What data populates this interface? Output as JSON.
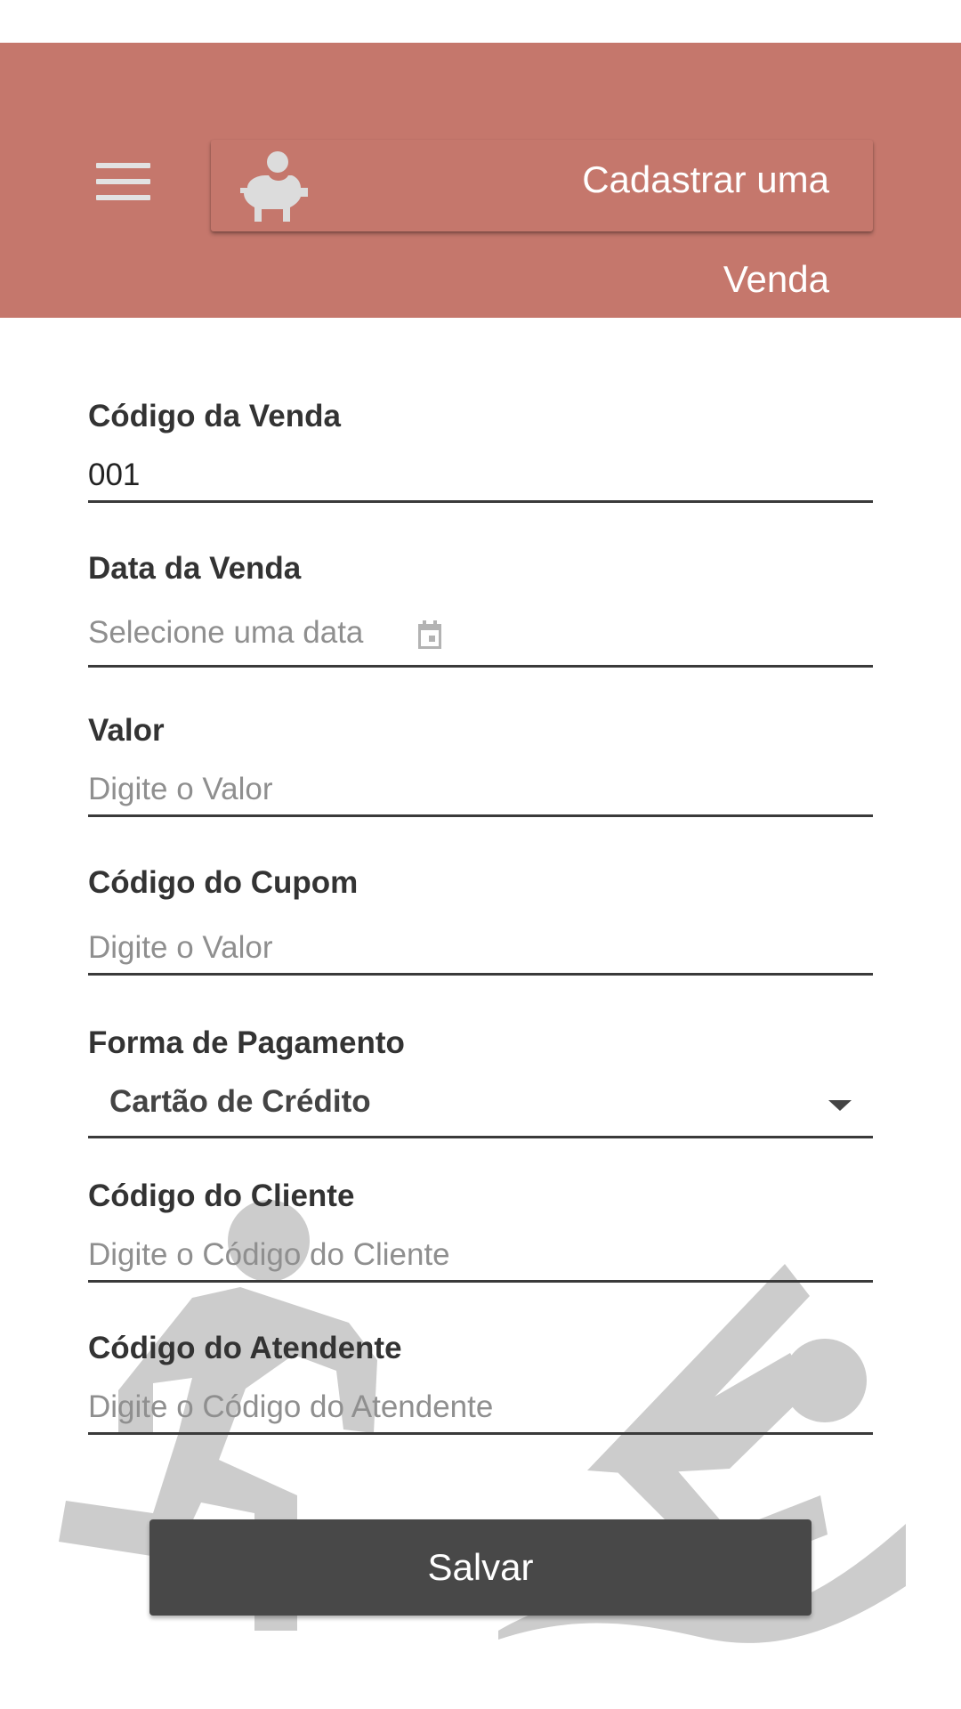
{
  "header": {
    "title_line1": "Cadastrar uma",
    "title_line2": "Venda",
    "background_color": "#c5776c",
    "menu_icon": "menu-icon",
    "logo_icon": "piggy-bank-icon"
  },
  "form": {
    "codigo_venda": {
      "label": "Código da Venda",
      "value": "001"
    },
    "data_venda": {
      "label": "Data da Venda",
      "placeholder": "Selecione uma data",
      "icon": "calendar-icon"
    },
    "valor": {
      "label": "Valor",
      "placeholder": "Digite o Valor"
    },
    "codigo_cupom": {
      "label": "Código do Cupom",
      "placeholder": "Digite o Valor"
    },
    "forma_pagamento": {
      "label": "Forma de Pagamento",
      "selected": "Cartão de Crédito"
    },
    "codigo_cliente": {
      "label": "Código do Cliente",
      "placeholder": "Digite o Código do Cliente"
    },
    "codigo_atendente": {
      "label": "Código do Atendente",
      "placeholder": "Digite o Código do Atendente"
    },
    "save_label": "Salvar"
  },
  "colors": {
    "header": "#c5776c",
    "button": "#484848",
    "watermark": "#cccccc"
  }
}
